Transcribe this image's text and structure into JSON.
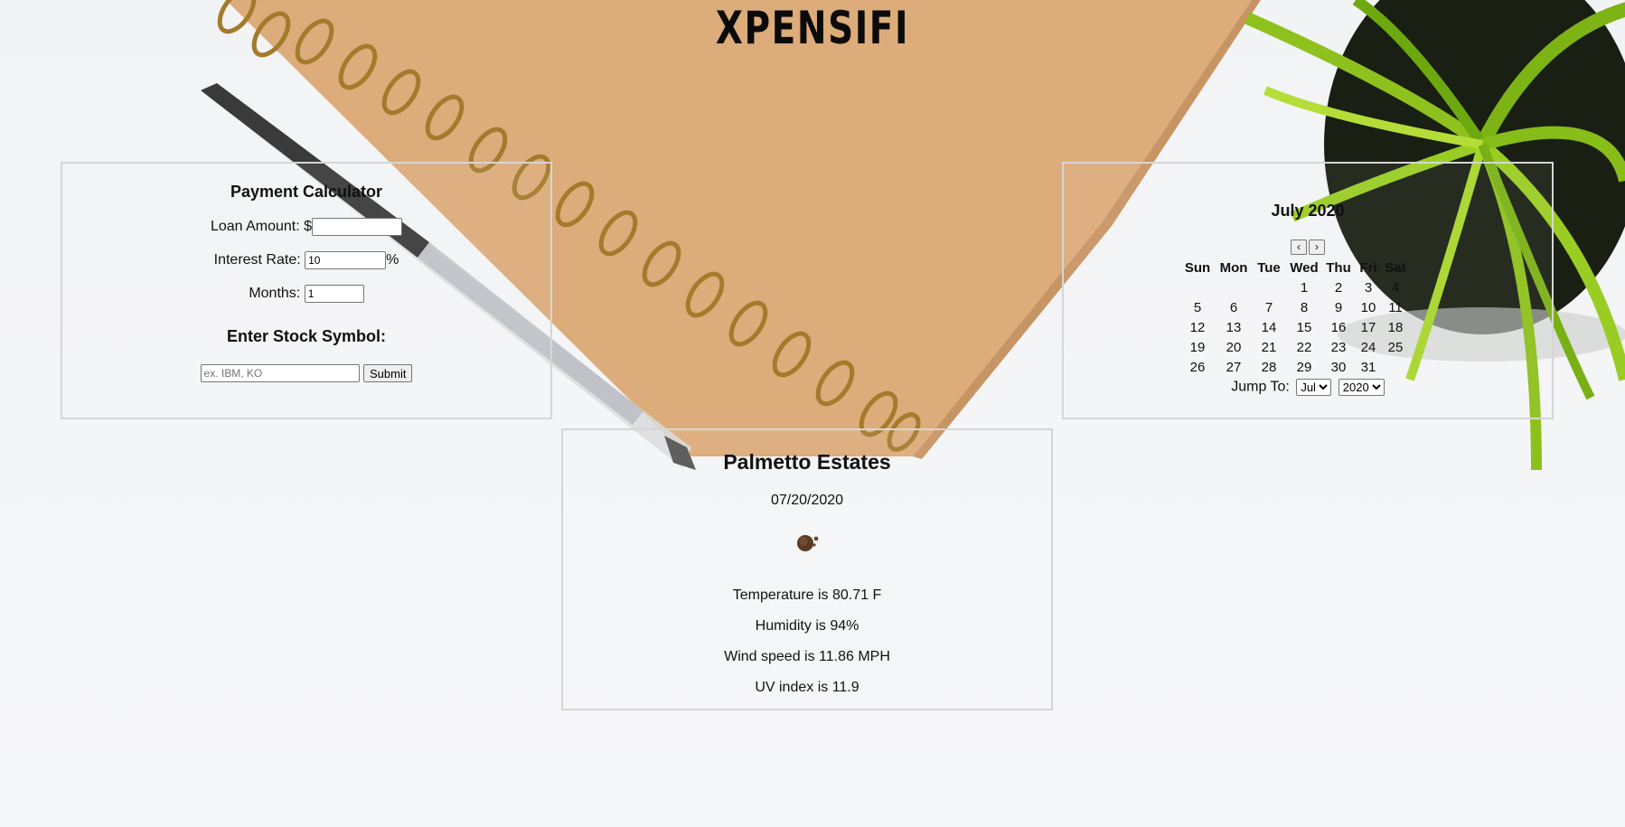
{
  "app": {
    "logo": "XPENSIFI"
  },
  "calculator": {
    "title": "Payment Calculator",
    "loan_label": "Loan Amount:",
    "loan_prefix": "$",
    "loan_value": "",
    "rate_label": "Interest Rate:",
    "rate_value": "10",
    "rate_suffix": "%",
    "months_label": "Months:",
    "months_value": "1",
    "stock_title": "Enter Stock Symbol:",
    "stock_placeholder": "ex. IBM, KO",
    "submit_label": "Submit"
  },
  "calendar": {
    "title": "July 2020",
    "prev_label": "‹",
    "next_label": "›",
    "weekdays": [
      "Sun",
      "Mon",
      "Tue",
      "Wed",
      "Thu",
      "Fri",
      "Sat"
    ],
    "weeks": [
      [
        "",
        "",
        "",
        "1",
        "2",
        "3",
        "4"
      ],
      [
        "5",
        "6",
        "7",
        "8",
        "9",
        "10",
        "11"
      ],
      [
        "12",
        "13",
        "14",
        "15",
        "16",
        "17",
        "18"
      ],
      [
        "19",
        "20",
        "21",
        "22",
        "23",
        "24",
        "25"
      ],
      [
        "26",
        "27",
        "28",
        "29",
        "30",
        "31",
        ""
      ]
    ],
    "jump_label": "Jump To:",
    "month_selected": "Jul",
    "year_selected": "2020"
  },
  "weather": {
    "location": "Palmetto Estates",
    "date": "07/20/2020",
    "icon": "cloud-night-icon",
    "temperature": "Temperature is 80.71 F",
    "humidity": "Humidity is 94%",
    "wind": "Wind speed is 11.86 MPH",
    "uv": "UV index is 11.9"
  }
}
